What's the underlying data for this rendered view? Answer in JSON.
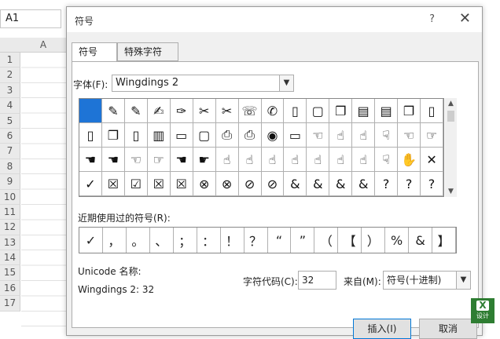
{
  "sheet": {
    "name_box": "A1",
    "column_header": "A",
    "row_headers": [
      "1",
      "2",
      "3",
      "4",
      "5",
      "6",
      "7",
      "8",
      "9",
      "10",
      "11",
      "12",
      "13",
      "14",
      "15",
      "16",
      "17"
    ]
  },
  "dialog": {
    "title": "符号",
    "help": "?",
    "close": "✕",
    "tabs": [
      {
        "label": "符号(S)"
      },
      {
        "label": "特殊字符(P)"
      }
    ],
    "font_label": "字体(F):",
    "font_value": "Wingdings 2",
    "symbols": [
      "",
      "✎",
      "✎",
      "✍",
      "✑",
      "✂",
      "✂",
      "☏",
      "✆",
      "▯",
      "▢",
      "❐",
      "▤",
      "▤",
      "❐",
      "▯",
      "▯",
      "❐",
      "▯",
      "▥",
      "▭",
      "▢",
      "⎙",
      "⎙",
      "◉",
      "▭",
      "☜",
      "☝",
      "☝",
      "☟",
      "☜",
      "☞",
      "☚",
      "☚",
      "☜",
      "☞",
      "☚",
      "☛",
      "☝",
      "☝",
      "☝",
      "☝",
      "☝",
      "☝",
      "☝",
      "☟",
      "✋",
      "✕",
      "✓",
      "☒",
      "☑",
      "☒",
      "☒",
      "⊗",
      "⊗",
      "⊘",
      "⊘",
      "&",
      "&",
      "&",
      "&",
      "?",
      "?",
      "?"
    ],
    "recent_label": "近期使用过的符号(R):",
    "recent": [
      "✓",
      "，",
      "。",
      "、",
      "；",
      "：",
      "！",
      "？",
      "“",
      "”",
      "（",
      "【",
      "）",
      "%",
      "&",
      "】"
    ],
    "unicode_label": "Unicode 名称:",
    "unicode_value": "Wingdings 2: 32",
    "code_label": "字符代码(C):",
    "code_value": "32",
    "from_label": "来自(M):",
    "from_value": "符号(十进制)",
    "insert_label": "插入(I)",
    "cancel_label": "取消"
  },
  "badge": {
    "top": "X",
    "bottom": "设计"
  },
  "colors": {
    "selected": "#1e74d6",
    "dialog_bg": "#f0f0f0",
    "badge": "#2e7d32"
  }
}
